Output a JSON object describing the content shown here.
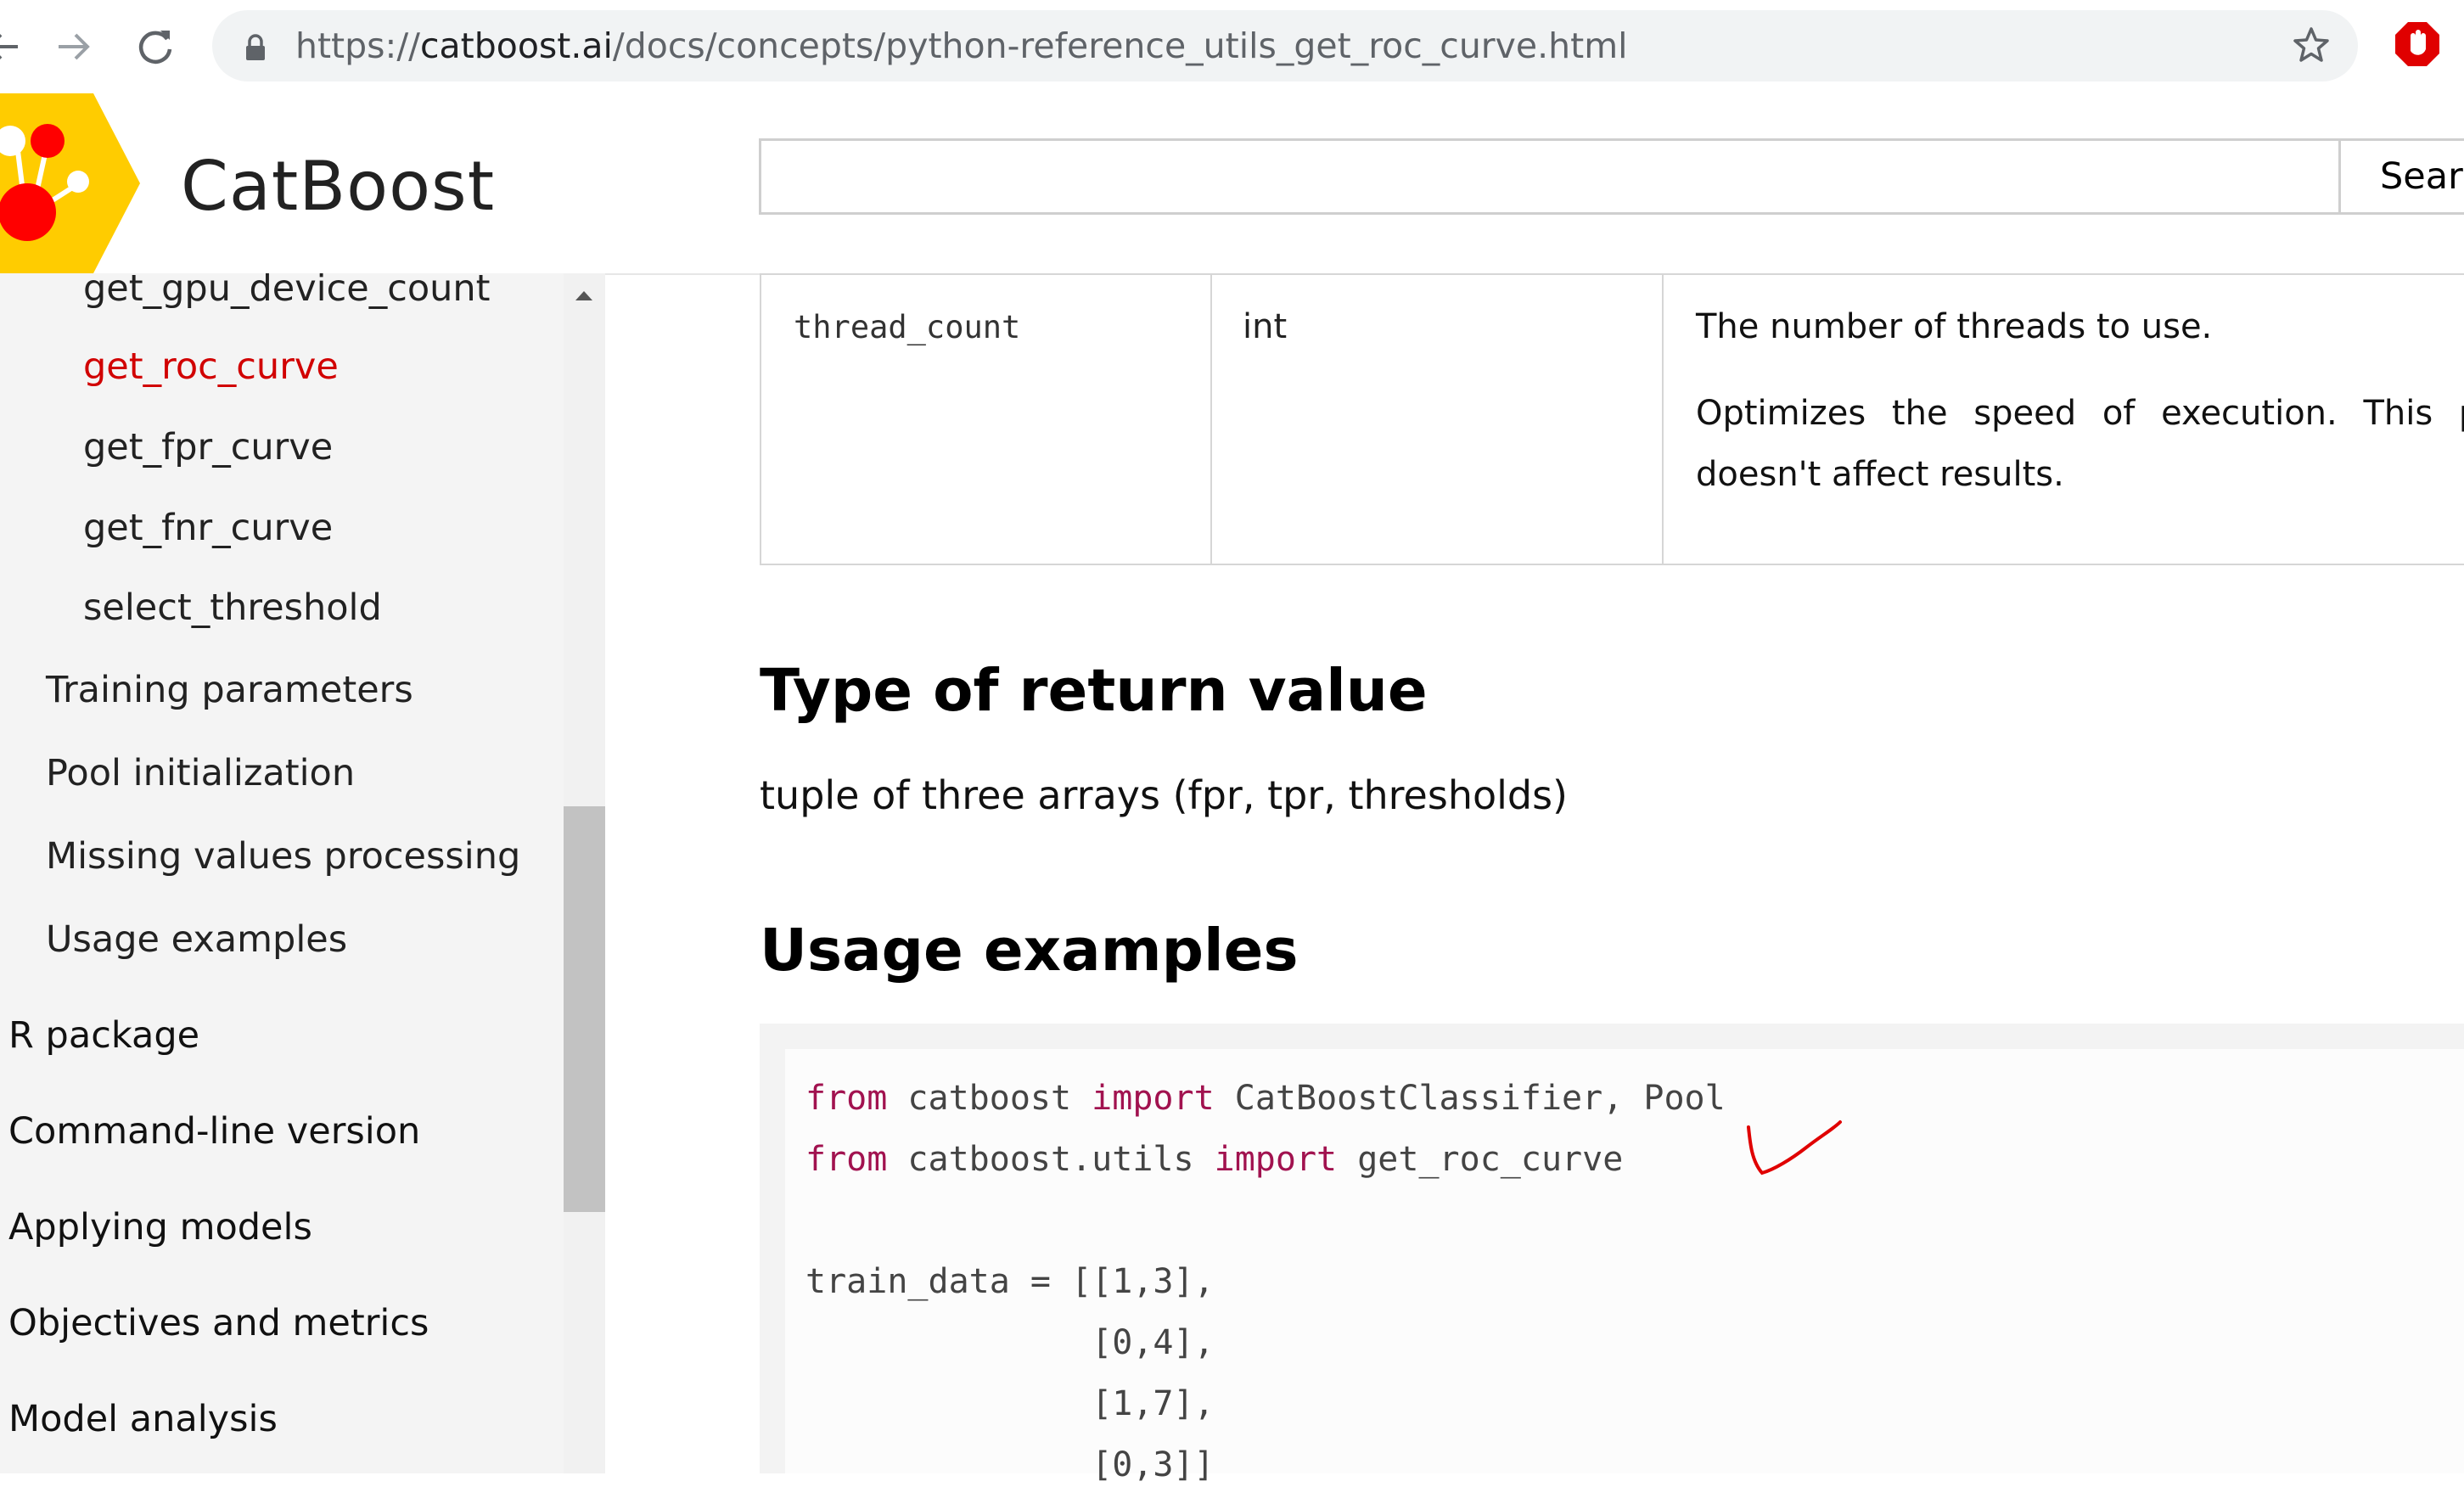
{
  "browser": {
    "url_scheme": "https://",
    "url_host": "catboost.ai",
    "url_path": "/docs/concepts/python-reference_utils_get_roc_curve.html"
  },
  "header": {
    "brand": "CatBoost",
    "search_placeholder": "",
    "search_button": "Sear"
  },
  "sidebar": {
    "items": [
      {
        "label": "get_gpu_device_count"
      },
      {
        "label": "get_roc_curve"
      },
      {
        "label": "get_fpr_curve"
      },
      {
        "label": "get_fnr_curve"
      },
      {
        "label": "select_threshold"
      },
      {
        "label": "Training parameters"
      },
      {
        "label": "Pool initialization"
      },
      {
        "label": "Missing values processing"
      },
      {
        "label": "Usage examples"
      },
      {
        "label": "R package"
      },
      {
        "label": "Command-line version"
      },
      {
        "label": "Applying models"
      },
      {
        "label": "Objectives and metrics"
      },
      {
        "label": "Model analysis"
      }
    ]
  },
  "params_table": {
    "row": {
      "name": "thread_count",
      "type": "int",
      "desc_line1": "The number of threads to use.",
      "desc_line2": "Optimizes the speed of execution. This param",
      "desc_line3": "doesn't affect results."
    }
  },
  "return_section": {
    "heading": "Type of return value",
    "text": "tuple of three arrays (fpr, tpr, thresholds)"
  },
  "usage_section": {
    "heading": "Usage examples",
    "code": {
      "l1_kw1": "from",
      "l1_a": " catboost ",
      "l1_kw2": "import",
      "l1_b": " CatBoostClassifier, Pool",
      "l2_kw1": "from",
      "l2_a": " catboost.utils ",
      "l2_kw2": "import",
      "l2_b": " get_roc_curve",
      "l4": "train_data = [[1,3],",
      "l5": "              [0,4],",
      "l6": "              [1,7],",
      "l7": "              [0,3]]"
    }
  },
  "colors": {
    "active_link": "#d10000",
    "keyword": "#a1124f",
    "logo_yellow": "#ffcc00",
    "logo_red": "#ff0000",
    "annotation": "#e00000"
  }
}
